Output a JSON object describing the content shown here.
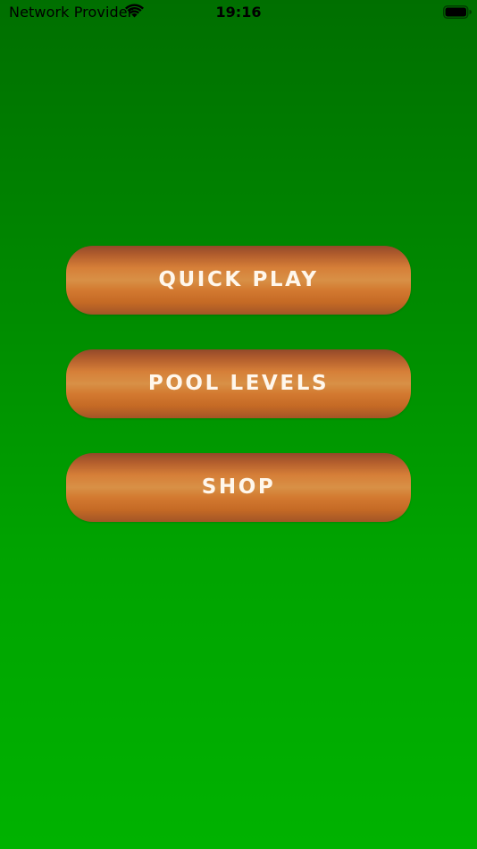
{
  "status_bar": {
    "carrier": "Network Provider",
    "time": "19:16",
    "wifi_icon": "wifi-icon",
    "battery_icon": "battery-icon"
  },
  "menu": {
    "buttons": [
      {
        "label": "QUICK PLAY"
      },
      {
        "label": "POOL LEVELS"
      },
      {
        "label": "SHOP"
      }
    ]
  },
  "colors": {
    "background_top": "#006f00",
    "background_bottom": "#00b200",
    "button_light": "#d89046",
    "button_dark": "#93492a",
    "button_text": "#fff7ec"
  }
}
